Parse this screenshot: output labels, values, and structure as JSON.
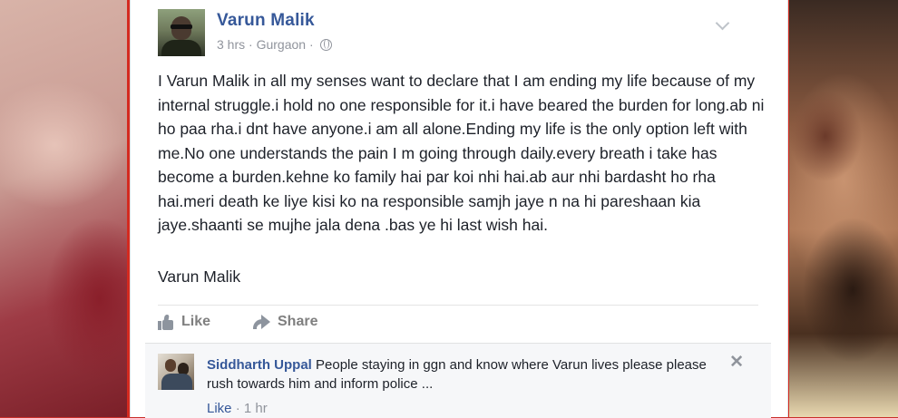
{
  "post": {
    "author": "Varun Malik",
    "time": "3 hrs",
    "separator": " · ",
    "location": "Gurgaon",
    "separator2": " · ",
    "text": "I Varun Malik in all my senses want to declare that I am ending my life because of my internal struggle.i hold no one responsible for it.i have beared the burden for long.ab ni ho paa rha.i dnt have anyone.i am all alone.Ending my life is the only option left with me.No one understands the pain I m going through daily.every breath i take has become a burden.kehne ko family hai par koi nhi hai.ab aur nhi bardasht ho rha hai.meri death ke liye kisi ko na responsible samjh jaye n na hi pareshaan kia jaye.shaanti se mujhe jala dena .bas ye hi last wish hai.",
    "signature": "Varun Malik"
  },
  "actions": {
    "like_label": "Like",
    "share_label": "Share"
  },
  "comment": {
    "author": "Siddharth Uppal",
    "text": " People staying in ggn and know where Varun lives please please rush towards him and inform police ...",
    "like_label": "Like",
    "separator": " · ",
    "time": "1 hr",
    "close_symbol": "✕"
  },
  "icons": {
    "privacy": "globe-icon",
    "menu": "chevron-down-icon",
    "like": "thumbs-up-icon",
    "share": "share-arrow-icon",
    "close": "close-icon"
  },
  "colors": {
    "link_blue": "#365899",
    "meta_gray": "#90949c",
    "text": "#1d2129",
    "frame_red": "#d42a20"
  }
}
